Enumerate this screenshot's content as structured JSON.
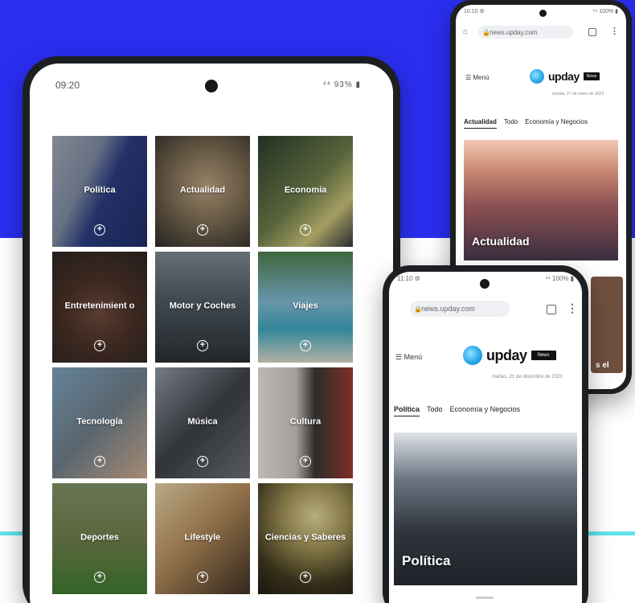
{
  "colors": {
    "brand_blue": "#2a2ef0",
    "accent_cyan": "#62e3ef",
    "phone_frame": "#1e1f22"
  },
  "main_phone": {
    "status_time": "09:20",
    "status_right": "⁴⁴ 93% ▮",
    "categories": [
      {
        "label": "Política",
        "icon": "plus-circle-icon"
      },
      {
        "label": "Actualidad",
        "icon": "plus-circle-icon"
      },
      {
        "label": "Economía",
        "icon": "plus-circle-icon"
      },
      {
        "label": "Entretenimient o",
        "icon": "plus-circle-icon"
      },
      {
        "label": "Motor y Coches",
        "icon": "plus-circle-icon"
      },
      {
        "label": "Viajes",
        "icon": "plus-circle-icon"
      },
      {
        "label": "Tecnología",
        "icon": "plus-circle-icon"
      },
      {
        "label": "Música",
        "icon": "plus-circle-icon"
      },
      {
        "label": "Cultura",
        "icon": "plus-circle-icon"
      },
      {
        "label": "Deportes",
        "icon": "plus-circle-icon"
      },
      {
        "label": "Lifestyle",
        "icon": "plus-circle-icon"
      },
      {
        "label": "Ciencias y Saberes",
        "icon": "plus-circle-icon"
      }
    ]
  },
  "top_right_phone": {
    "status_time": "10:10 ⚙",
    "status_right": "⁴⁴ 100% ▮",
    "url": "news.upday.com",
    "menu": "☰ Menú",
    "logo_text": "upday",
    "logo_pill": "News",
    "date_line": "martes, 27 de enero de 2023",
    "tabs": [
      "Actualidad",
      "Todo",
      "Economía y Negocios"
    ],
    "hero_title": "Actualidad",
    "side_card_text": "s el"
  },
  "bottom_right_phone": {
    "status_time": "11:10 ⚙",
    "status_right": "⁴⁴ 100% ▮",
    "url": "news.upday.com",
    "menu": "☰ Menú",
    "logo_text": "upday",
    "logo_pill": "News",
    "date_line": "martes, 21 de diciembre de 2023",
    "tabs": [
      "Política",
      "Todo",
      "Economía y Negocios"
    ],
    "hero_title": "Política"
  }
}
